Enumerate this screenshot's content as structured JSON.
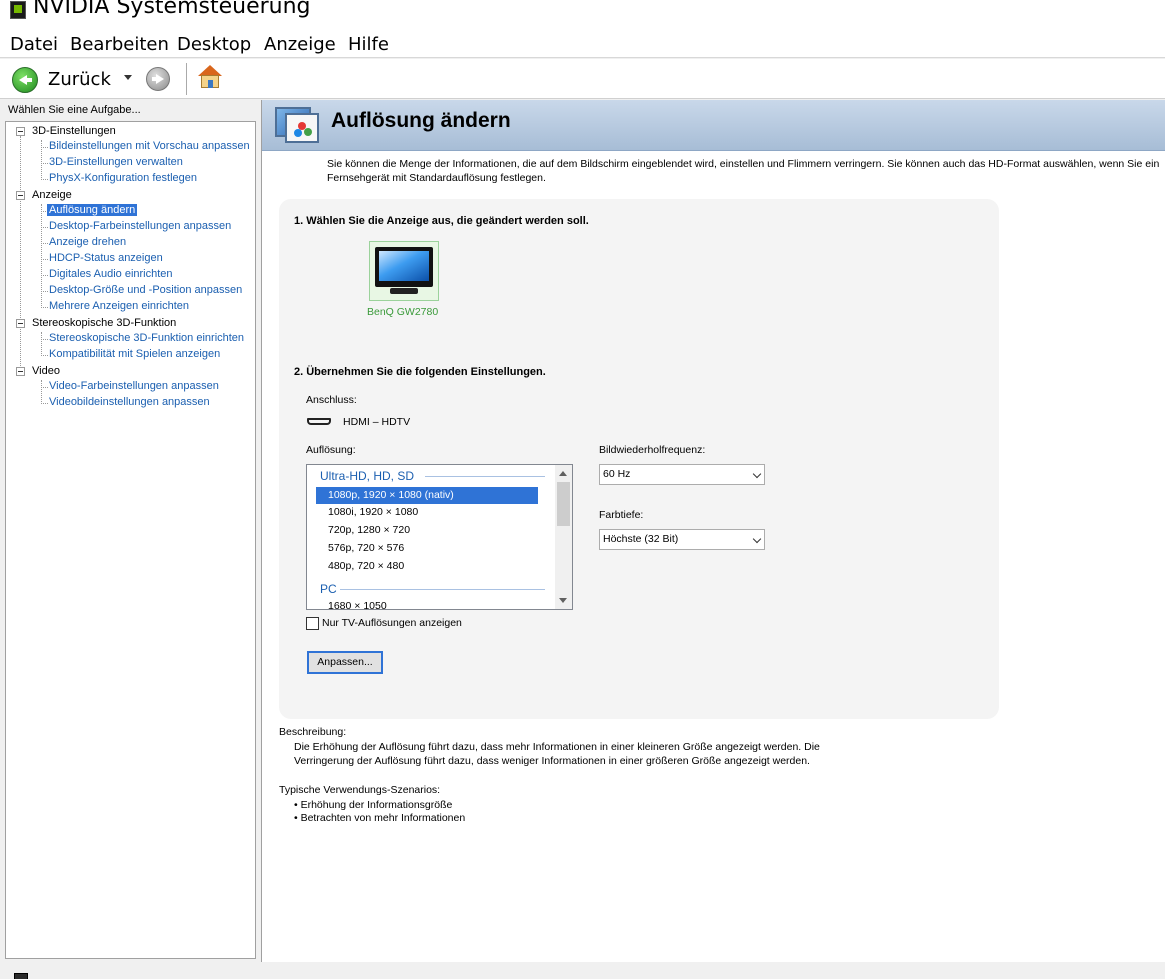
{
  "window": {
    "title": "NVIDIA Systemsteuerung"
  },
  "menu": [
    "Datei",
    "Bearbeiten",
    "Desktop",
    "Anzeige",
    "Hilfe"
  ],
  "toolbar": {
    "back_label": "Zurück"
  },
  "sidebar": {
    "task_label": "Wählen Sie eine Aufgabe...",
    "categories": [
      {
        "label": "3D-Einstellungen",
        "items": [
          "Bildeinstellungen mit Vorschau anpassen",
          "3D-Einstellungen verwalten",
          "PhysX-Konfiguration festlegen"
        ]
      },
      {
        "label": "Anzeige",
        "items": [
          "Auflösung ändern",
          "Desktop-Farbeinstellungen anpassen",
          "Anzeige drehen",
          "HDCP-Status anzeigen",
          "Digitales Audio einrichten",
          "Desktop-Größe und -Position anpassen",
          "Mehrere Anzeigen einrichten"
        ]
      },
      {
        "label": "Stereoskopische 3D-Funktion",
        "items": [
          "Stereoskopische 3D-Funktion einrichten",
          "Kompatibilität mit Spielen anzeigen"
        ]
      },
      {
        "label": "Video",
        "items": [
          "Video-Farbeinstellungen anpassen",
          "Videobildeinstellungen anpassen"
        ]
      }
    ],
    "selected": "Auflösung ändern"
  },
  "page": {
    "title": "Auflösung ändern",
    "intro_line1": "Sie können die Menge der Informationen, die auf dem Bildschirm eingeblendet wird, einstellen und Flimmern verringern. Sie können auch das HD-Format auswählen, wenn Sie ein",
    "intro_line2": "Fernsehgerät mit Standardauflösung festlegen.",
    "step1": "1. Wählen Sie die Anzeige aus, die geändert werden soll.",
    "display_name": "BenQ GW2780",
    "step2": "2. Übernehmen Sie die folgenden Einstellungen.",
    "connector_label": "Anschluss:",
    "connector_value": "HDMI – HDTV",
    "resolution_label": "Auflösung:",
    "resolution_groups": [
      {
        "name": "Ultra-HD, HD, SD",
        "items": [
          "1080p, 1920 × 1080 (nativ)",
          "1080i, 1920 × 1080",
          "720p, 1280 × 720",
          "576p, 720 × 576",
          "480p, 720 × 480"
        ]
      },
      {
        "name": "PC",
        "items": [
          "1680 × 1050"
        ]
      }
    ],
    "resolution_selected": "1080p, 1920 × 1080 (nativ)",
    "refresh_label": "Bildwiederholfrequenz:",
    "refresh_value": "60 Hz",
    "depth_label": "Farbtiefe:",
    "depth_value": "Höchste (32 Bit)",
    "tv_only_label": "Nur TV-Auflösungen anzeigen",
    "tv_only_checked": false,
    "customize_button": "Anpassen...",
    "description_label": "Beschreibung:",
    "description_line1": "Die Erhöhung der Auflösung führt dazu, dass mehr Informationen in einer kleineren Größe angezeigt werden. Die",
    "description_line2": "Verringerung der Auflösung führt dazu, dass weniger Informationen in einer größeren Größe angezeigt werden.",
    "scenarios_label": "Typische Verwendungs-Szenarios:",
    "scenarios": [
      "Erhöhung der Informationsgröße",
      "Betrachten von mehr Informationen"
    ]
  },
  "colors": {
    "link": "#1b5fb0",
    "selection": "#2f73d6",
    "banner": "#b7cbe1",
    "display_label": "#3a9a3a"
  }
}
